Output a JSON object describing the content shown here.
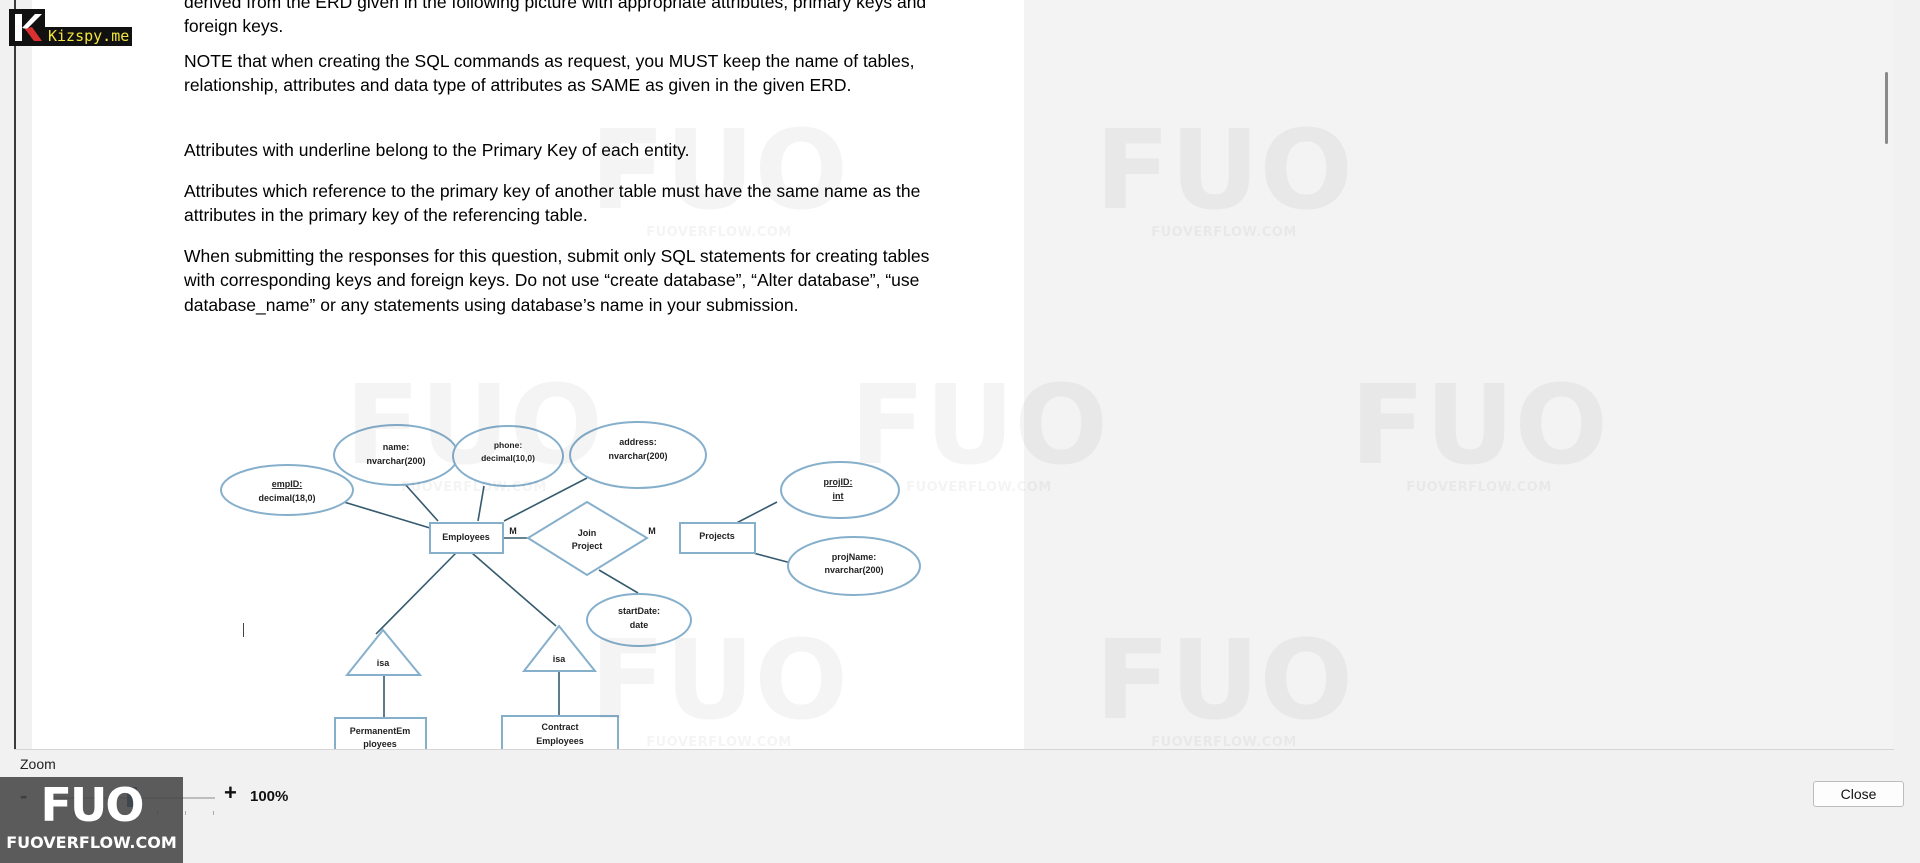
{
  "document": {
    "paragraphs": [
      "derived from the ERD given in the following picture with appropriate attributes, primary keys and foreign keys.",
      "NOTE that when creating the SQL commands as request, you MUST keep the name of tables, relationship, attributes and data type of attributes as SAME as given in the given ERD.",
      "Attributes with underline belong to the Primary Key of each entity.",
      "Attributes which reference to the primary key of another table must have the same name as the attributes in the primary key of the referencing table.",
      "When submitting the responses for this question, submit only SQL statements for creating tables with corresponding keys and foreign keys. Do not use “create database”, “Alter database”, “use database_name” or any statements using database’s name in your submission."
    ]
  },
  "erd": {
    "entities": {
      "employees": "Employees",
      "projects": "Projects",
      "permanent_line1": "PermanentEm",
      "permanent_line2": "ployees",
      "contract_line1": "Contract",
      "contract_line2": "Employees"
    },
    "relationship": {
      "line1": "Join",
      "line2": "Project",
      "card_left": "M",
      "card_right": "M"
    },
    "isa_left": "isa",
    "isa_right": "isa",
    "attributes": {
      "empid_name": "empID:",
      "empid_type": "decimal(18,0)",
      "name_name": "name:",
      "name_type": "nvarchar(200)",
      "phone_name": "phone:",
      "phone_type": "decimal(10,0)",
      "address_name": "address:",
      "address_type": "nvarchar(200)",
      "projid_name": "projID:",
      "projid_type": "int",
      "projname_name": "projName:",
      "projname_type": "nvarchar(200)",
      "startdate_name": "startDate:",
      "startdate_type": "date"
    }
  },
  "watermarks": {
    "logo": "FUO",
    "site": "FUOVERFLOW.COM"
  },
  "overlay": {
    "site_badge": "Kizspy.me"
  },
  "footer": {
    "zoom_label": "Zoom",
    "zoom_minus": "-",
    "zoom_plus": "+",
    "zoom_value": "100%",
    "zoom_level_percent": 100,
    "close_label": "Close",
    "badge_logo": "FUO",
    "badge_name": "FUOVERFLOW.COM"
  }
}
